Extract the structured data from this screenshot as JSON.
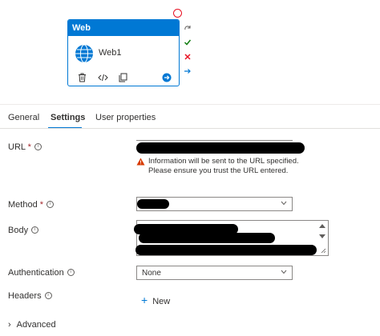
{
  "activity": {
    "header": "Web",
    "name": "Web1",
    "icons": [
      "globe-icon",
      "delete-icon",
      "code-icon",
      "copy-icon",
      "arrow-right-circle-icon"
    ],
    "side_icons": [
      "redo-icon",
      "check-icon",
      "close-icon",
      "arrow-right-icon"
    ]
  },
  "tabs": [
    {
      "label": "General",
      "active": false
    },
    {
      "label": "Settings",
      "active": true
    },
    {
      "label": "User properties",
      "active": false
    }
  ],
  "form": {
    "url": {
      "label": "URL",
      "required": "*"
    },
    "warning": "Information will be sent to the URL specified. Please ensure you trust the URL entered.",
    "method": {
      "label": "Method",
      "required": "*"
    },
    "body": {
      "label": "Body"
    },
    "authentication": {
      "label": "Authentication",
      "value": "None"
    },
    "headers": {
      "label": "Headers",
      "new_label": "New"
    },
    "advanced": {
      "label": "Advanced"
    }
  },
  "colors": {
    "accent": "#0078d4",
    "required": "#a4262c",
    "warning": "#d83b01",
    "error": "#e81123",
    "success": "#107c10"
  }
}
